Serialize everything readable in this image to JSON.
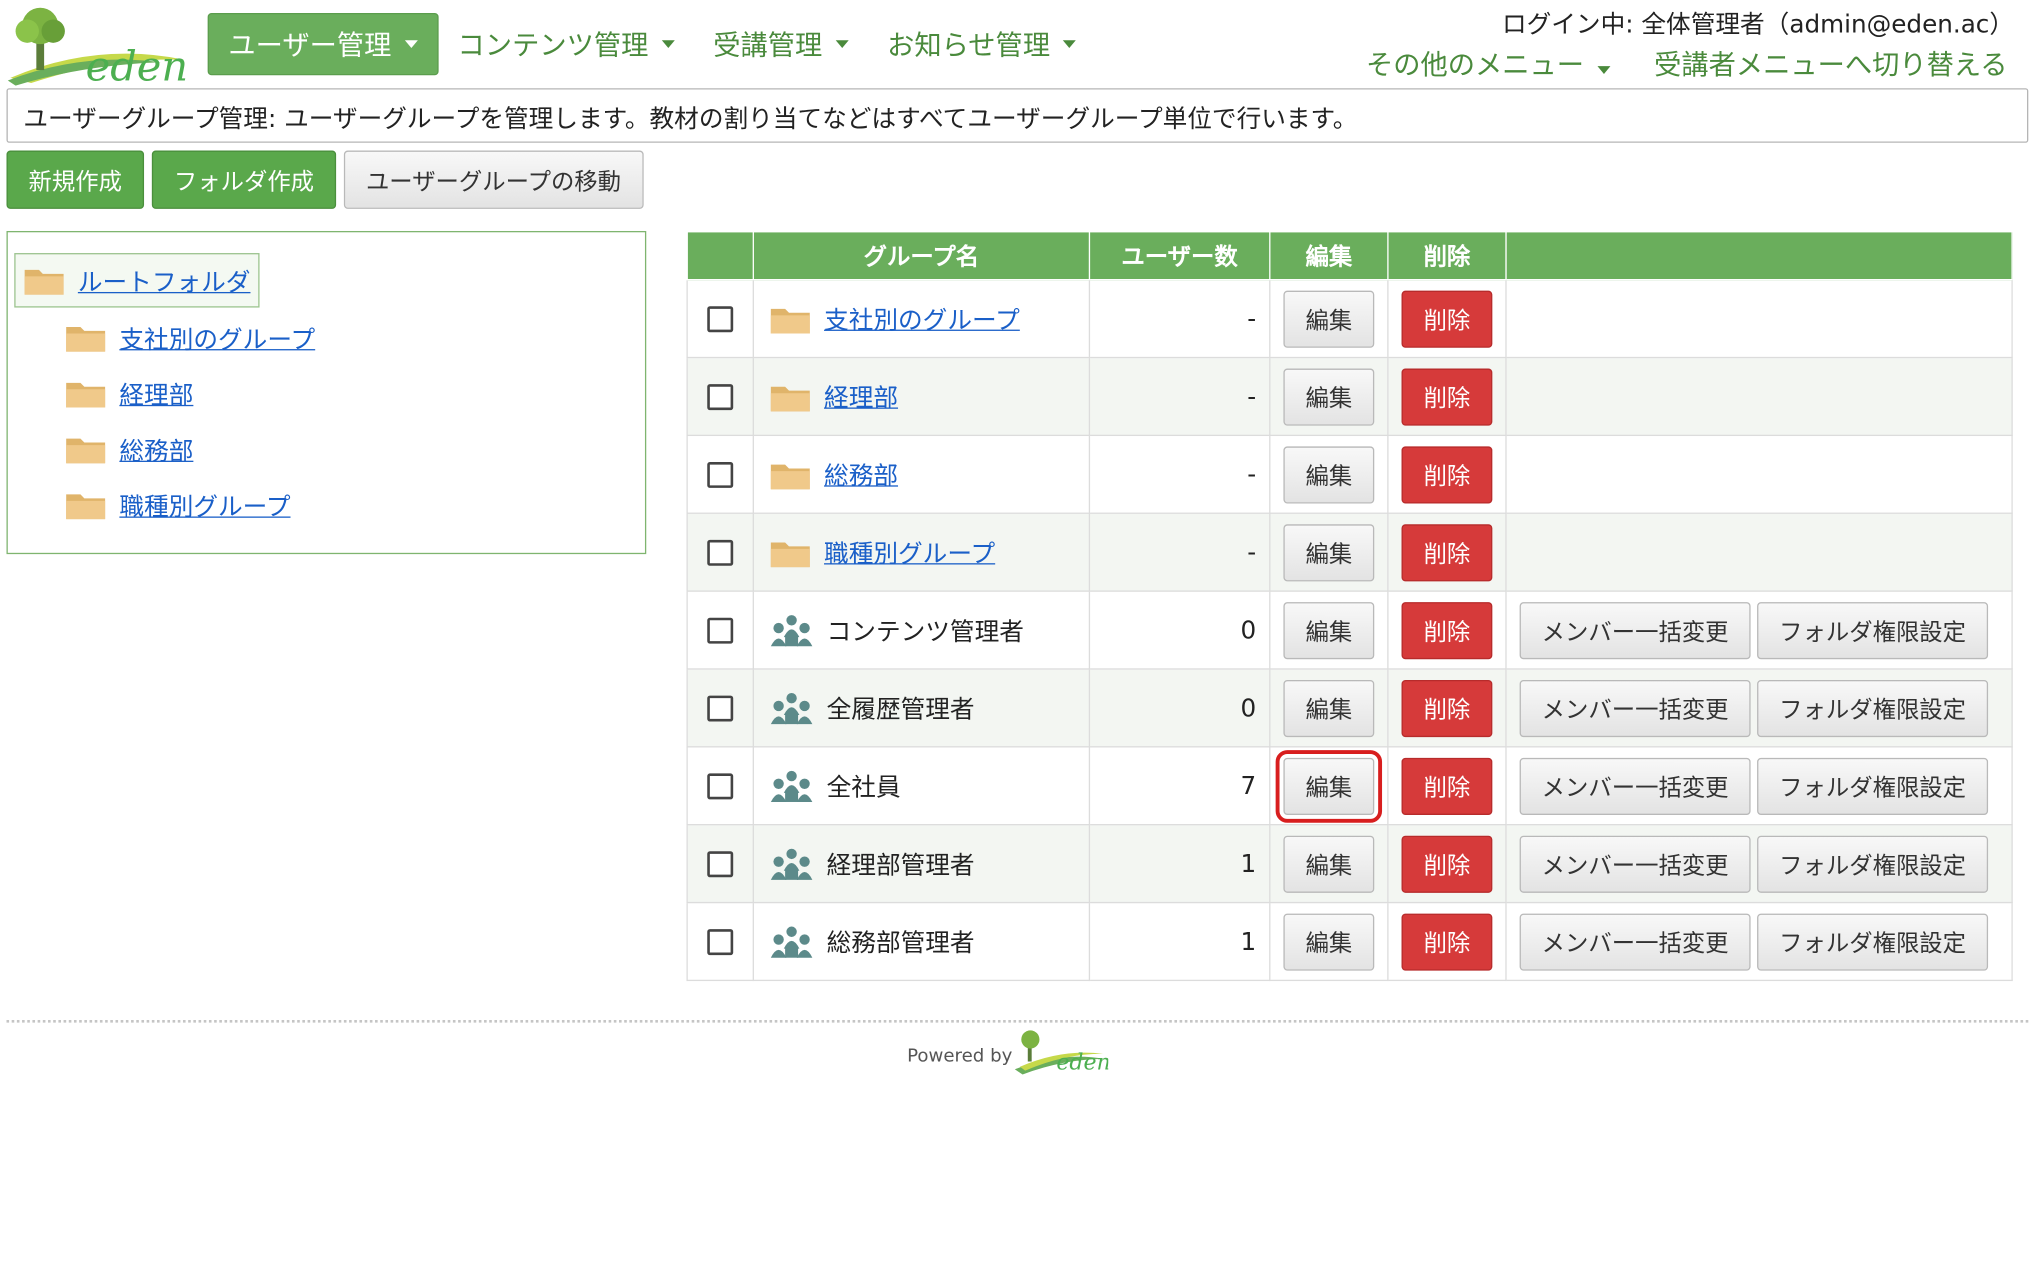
{
  "header": {
    "nav": [
      {
        "label": "ユーザー管理",
        "active": true
      },
      {
        "label": "コンテンツ管理"
      },
      {
        "label": "受講管理"
      },
      {
        "label": "お知らせ管理"
      }
    ],
    "login_info": "ログイン中: 全体管理者（admin@eden.ac）",
    "other_menu": "その他のメニュー",
    "switch_menu": "受講者メニューへ切り替える"
  },
  "description": "ユーザーグループ管理: ユーザーグループを管理します。教材の割り当てなどはすべてユーザーグループ単位で行います。",
  "toolbar": {
    "new_label": "新規作成",
    "folder_label": "フォルダ作成",
    "move_label": "ユーザーグループの移動"
  },
  "tree": {
    "root": "ルートフォルダ",
    "children": [
      "支社別のグループ",
      "経理部",
      "総務部",
      "職種別グループ"
    ]
  },
  "table": {
    "headers": [
      "グループ名",
      "ユーザー数",
      "編集",
      "削除"
    ],
    "edit_label": "編集",
    "delete_label": "削除",
    "bulk_label": "メンバー一括変更",
    "perm_label": "フォルダ権限設定",
    "rows": [
      {
        "type": "folder",
        "name": "支社別のグループ",
        "count": "-"
      },
      {
        "type": "folder",
        "name": "経理部",
        "count": "-"
      },
      {
        "type": "folder",
        "name": "総務部",
        "count": "-"
      },
      {
        "type": "folder",
        "name": "職種別グループ",
        "count": "-"
      },
      {
        "type": "group",
        "name": "コンテンツ管理者",
        "count": "0"
      },
      {
        "type": "group",
        "name": "全履歴管理者",
        "count": "0"
      },
      {
        "type": "group",
        "name": "全社員",
        "count": "7",
        "highlight_edit": true
      },
      {
        "type": "group",
        "name": "経理部管理者",
        "count": "1"
      },
      {
        "type": "group",
        "name": "総務部管理者",
        "count": "1"
      }
    ]
  },
  "footer": {
    "powered_by": "Powered by",
    "logo_text": "eden"
  },
  "logo_text": "eden",
  "colors": {
    "accent": "#6aae5c",
    "danger": "#d63a3a",
    "link": "#1a5fc8"
  }
}
